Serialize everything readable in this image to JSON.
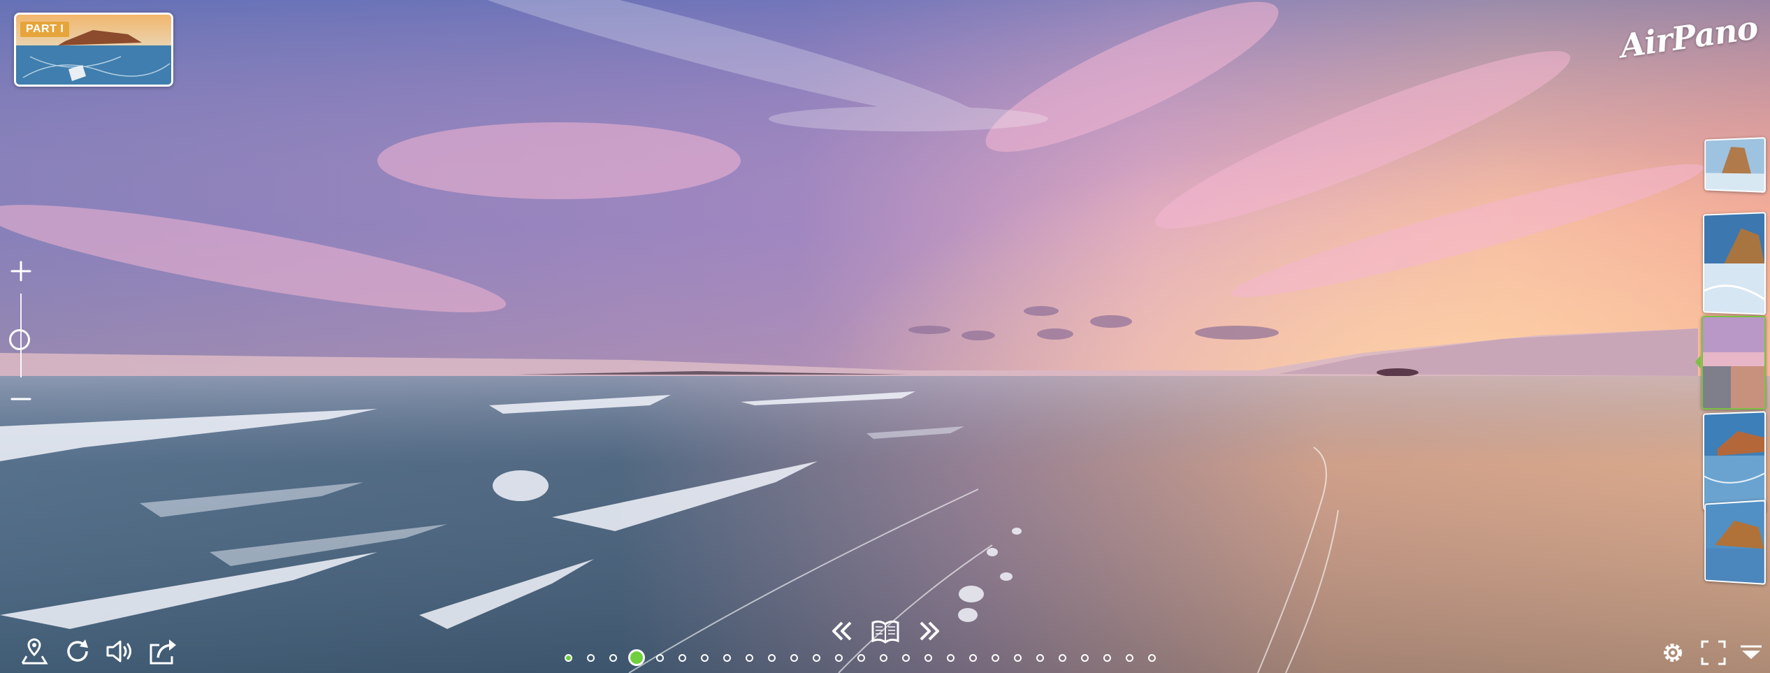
{
  "logo": {
    "text": "AirPano"
  },
  "thumbnail": {
    "badge": "PART I"
  },
  "zoom": {
    "in_icon": "plus-icon",
    "out_icon": "minus-icon",
    "level": 0.35
  },
  "side_thumbnails": [
    {
      "name": "thumb-1",
      "active": false
    },
    {
      "name": "thumb-2",
      "active": false
    },
    {
      "name": "thumb-3",
      "active": true
    },
    {
      "name": "thumb-4",
      "active": false
    },
    {
      "name": "thumb-5",
      "active": false
    }
  ],
  "toolbar_left": [
    "map-pin-icon",
    "rotate-icon",
    "sound-icon",
    "share-icon"
  ],
  "center_controls": [
    "previous-icon",
    "book-icon",
    "next-icon"
  ],
  "toolbar_right": [
    "settings-icon",
    "fullscreen-icon",
    "menu-collapse-icon"
  ],
  "pagination": {
    "total": 27,
    "current": 4,
    "visited": [
      1
    ]
  },
  "colors": {
    "accent": "#6fcf3c",
    "active_border": "#7ac142",
    "badge": "#e6a53a"
  }
}
